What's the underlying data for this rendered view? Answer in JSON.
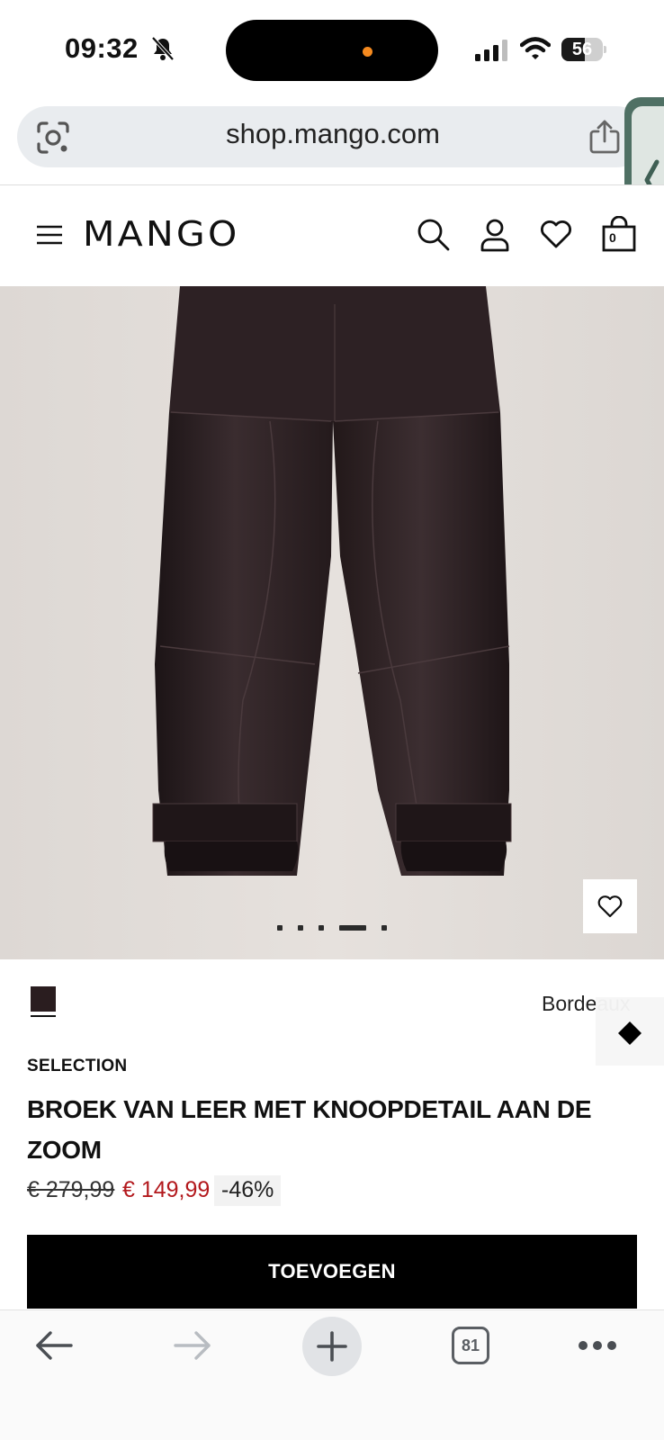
{
  "status_bar": {
    "time": "09:32",
    "battery_level": "56",
    "battery_fraction": 0.56,
    "icons": [
      "bell-slash-icon",
      "signal-icon",
      "wifi-icon",
      "battery-icon"
    ],
    "island_dot_color": "#f58a1f"
  },
  "browser": {
    "url": "shop.mango.com",
    "icons": [
      "lens-icon",
      "share-icon",
      "chevron-left-icon"
    ],
    "toolbar": {
      "tab_count": "81",
      "icons": [
        "arrow-left-icon",
        "arrow-right-icon",
        "plus-icon",
        "tabs-icon",
        "more-icon"
      ]
    }
  },
  "site_header": {
    "logo": "MANGO",
    "bag_count": "0",
    "icons": [
      "menu-icon",
      "search-icon",
      "account-icon",
      "heart-icon",
      "bag-icon"
    ]
  },
  "product": {
    "image_alt": "Leather trousers on a hanger",
    "carousel_total": 5,
    "carousel_active_index": 3,
    "color_name_visible": "Borde",
    "color_name_faded": "aux",
    "swatch_color": "#2a1d1f",
    "brand": "SELECTION",
    "title": "BROEK VAN LEER MET KNOOPDETAIL AAN DE ZOOM",
    "price_old": "€ 279,99",
    "price_new": "€ 149,99",
    "discount": "-46%",
    "add_button": "TOEVOEGEN",
    "accent_red": "#b3191d"
  }
}
